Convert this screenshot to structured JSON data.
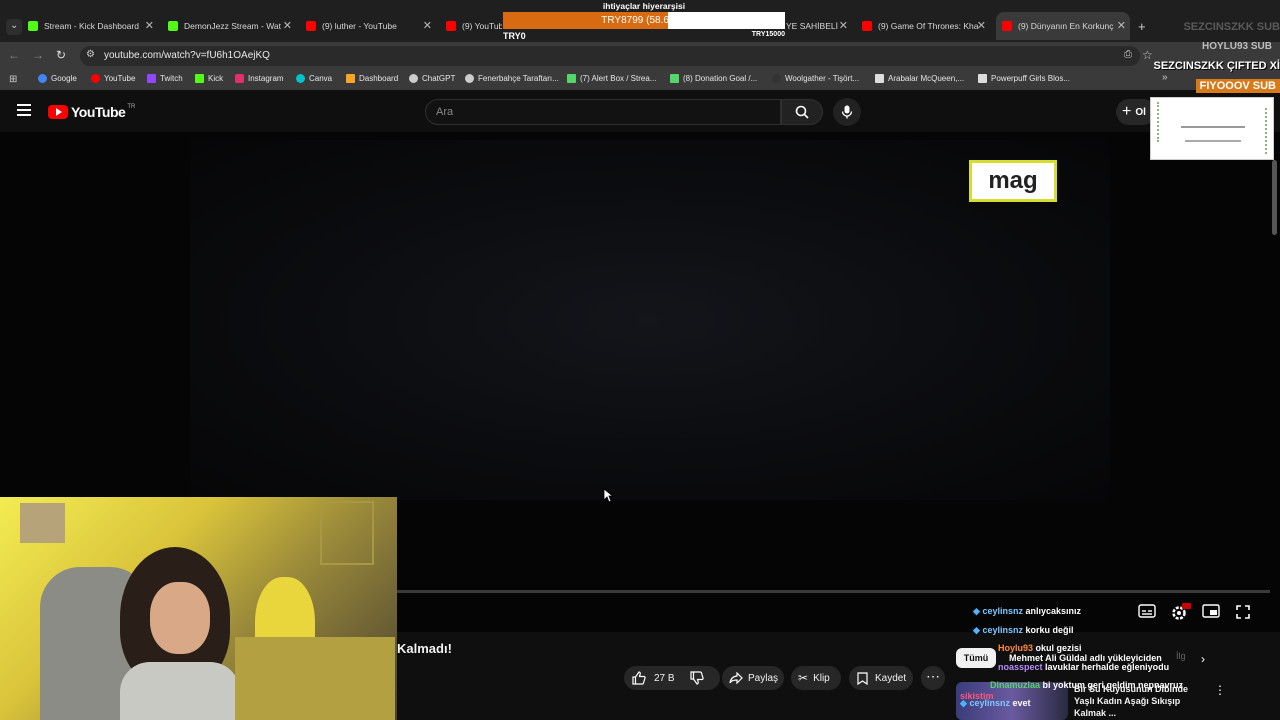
{
  "browser": {
    "tabs": [
      {
        "label": "Stream - Kick Dashboard",
        "color": "#53fc18",
        "active": false
      },
      {
        "label": "DemonJezz Stream - Wat",
        "color": "#53fc18",
        "active": false
      },
      {
        "label": "(9) luther - YouTube",
        "color": "#ff0000",
        "active": false
      },
      {
        "label": "(9) YouTube",
        "color": "#ff0000",
        "active": false
      },
      {
        "label": "YE SAHİBELİ",
        "color": "#ff0000",
        "active": false
      },
      {
        "label": "(9) Game Of Thrones: Kha",
        "color": "#ff0000",
        "active": false
      },
      {
        "label": "(9) Dünyanın En Korkunç",
        "color": "#ff0000",
        "active": true
      }
    ],
    "url": "youtube.com/watch?v=fU6h1OAejKQ",
    "bookmarks": [
      {
        "label": "Google",
        "color": "#4285f4"
      },
      {
        "label": "YouTube",
        "color": "#ff0000"
      },
      {
        "label": "Twitch",
        "color": "#9146ff"
      },
      {
        "label": "Kick",
        "color": "#53fc18"
      },
      {
        "label": "Instagram",
        "color": "#e1306c"
      },
      {
        "label": "Canva",
        "color": "#00c4cc"
      },
      {
        "label": "Dashboard",
        "color": "#f5a623"
      },
      {
        "label": "ChatGPT",
        "color": "#cccccc"
      },
      {
        "label": "Fenerbahçe Taraftarı...",
        "color": "#cccccc"
      },
      {
        "label": "(7) Alert Box / Strea...",
        "color": "#53d769"
      },
      {
        "label": "(8) Donation Goal /...",
        "color": "#53d769"
      },
      {
        "label": "Woolgather - Tişört...",
        "color": "#333333"
      },
      {
        "label": "Arabalar McQueen,...",
        "color": "#dddddd"
      },
      {
        "label": "Powerpuff Girls Blos...",
        "color": "#dddddd"
      }
    ]
  },
  "overlay": {
    "goal_title": "ihtiyaçlar hiyerarşisi",
    "goal_text": "TRY8799 (58.66%)",
    "goal_progress": 0.5866,
    "goal_start": "TRY0",
    "goal_end": "TRY15000",
    "sub_lines": [
      "SEZCINSZKK SUB",
      "HOYLU93 SUB",
      "SEZCINSZKK ÇIFTED Xİ",
      "FIYOOOV SUB"
    ]
  },
  "youtube": {
    "logo_text": "YouTube",
    "region": "TR",
    "search_placeholder": "Ara",
    "create_label": "Ol",
    "video_sign": "mag",
    "title_fragment": "Kalmadı!",
    "likes": "27 B",
    "share_label": "Paylaş",
    "clip_label": "Klip",
    "save_label": "Kaydet",
    "filter_chip": "Tümü",
    "next_chip": "İlg",
    "next_video_title": "Bir Su Kuyusunun Dibinde Yaşlı Kadın Aşağı Sıkışıp Kalmak ..."
  },
  "chat": [
    {
      "user": "ceylinsnz",
      "text": "anlıycaksınız",
      "ucolor": "#7ec8ff"
    },
    {
      "user": "ceylinsnz",
      "text": "korku değil",
      "ucolor": "#7ec8ff"
    },
    {
      "user": "Hoylu93",
      "text": "okul gezisi",
      "ucolor": "#ff8a3d"
    },
    {
      "user": "",
      "text": "Mehmet Ali Güldal adlı yükleyiciden",
      "ucolor": "#ffffff"
    },
    {
      "user": "noasspect",
      "text": "lavuklar herhalde eğleniyodu",
      "ucolor": "#b98bff"
    },
    {
      "user": "Dinamuzlaa",
      "text": "bi yoktum geri geldim nepnavruz",
      "ucolor": "#52d66a"
    },
    {
      "user": "sikistim",
      "text": "",
      "ucolor": "#ff5577"
    },
    {
      "user": "ceylinsnz",
      "text": "evet",
      "ucolor": "#7ec8ff"
    }
  ]
}
